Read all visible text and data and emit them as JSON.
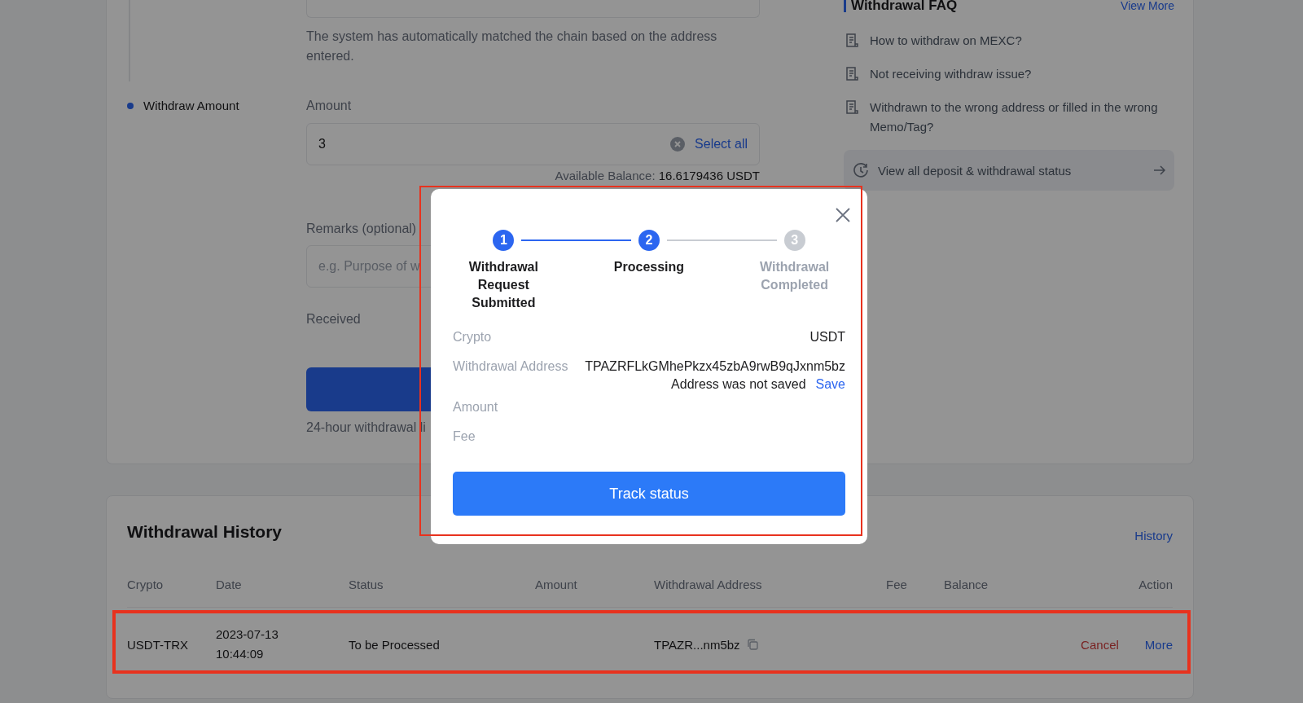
{
  "withdraw_form": {
    "chain_note": "The system has automatically matched the chain based on the address entered.",
    "section_label": "Withdraw Amount",
    "amount_label": "Amount",
    "amount_value": "3",
    "select_all": "Select all",
    "balance_label": "Available Balance:",
    "balance_value": "16.6179436 USDT",
    "remarks_label": "Remarks (optional)",
    "remarks_placeholder": "e.g. Purpose of w",
    "received_label": "Received",
    "limit_note": "24-hour withdrawal li"
  },
  "faq": {
    "title": "Withdrawal FAQ",
    "view_more": "View More",
    "items": [
      "How to withdraw on MEXC?",
      "Not receiving withdraw issue?",
      "Withdrawn to the wrong address or filled in the wrong Memo/Tag?"
    ],
    "status_link": "View all deposit & withdrawal status"
  },
  "history": {
    "title": "Withdrawal History",
    "history_link": "History",
    "columns": [
      "Crypto",
      "Date",
      "Status",
      "Amount",
      "Withdrawal Address",
      "Fee",
      "Balance",
      "Action"
    ],
    "rows": [
      {
        "crypto": "USDT-TRX",
        "date": "2023-07-13 10:44:09",
        "status": "To be Processed",
        "address": "TPAZR...nm5bz",
        "actions": [
          {
            "label": "Cancel",
            "kind": "cancel"
          },
          {
            "label": "More",
            "kind": "more"
          }
        ]
      }
    ]
  },
  "modal": {
    "steps": [
      {
        "number": "1",
        "label": "Withdrawal Request Submitted",
        "active": true
      },
      {
        "number": "2",
        "label": "Processing",
        "active": true
      },
      {
        "number": "3",
        "label": "Withdrawal Completed",
        "active": false
      }
    ],
    "details": [
      {
        "label": "Crypto",
        "value": "USDT"
      },
      {
        "label": "Withdrawal Address",
        "value": "TPAZRFLkGMhePkzx45zbA9rwB9qJxnm5bz",
        "note": "Address was not saved",
        "note_action": "Save"
      },
      {
        "label": "Amount"
      },
      {
        "label": "Fee"
      }
    ],
    "button": "Track status"
  }
}
